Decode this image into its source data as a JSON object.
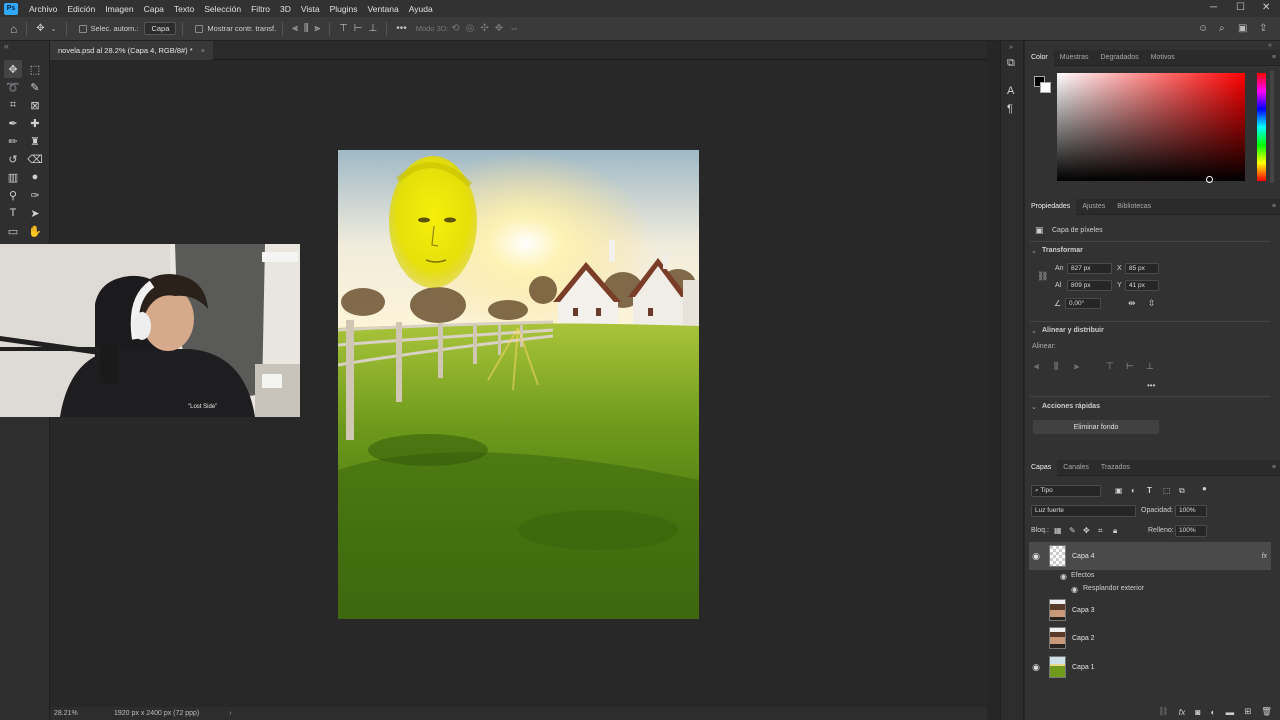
{
  "app": {
    "logo": "Ps"
  },
  "menu": [
    "Archivo",
    "Edición",
    "Imagen",
    "Capa",
    "Texto",
    "Selección",
    "Filtro",
    "3D",
    "Vista",
    "Plugins",
    "Ventana",
    "Ayuda"
  ],
  "options": {
    "auto_select_label": "Selec. autom.:",
    "auto_select_value": "Capa",
    "show_transform_label": "Mostrar contr. transf.",
    "mode_3d_label": "Modo 3D:"
  },
  "document": {
    "tab_title": "novela.psd al 28.2% (Capa 4, RGB/8#) *",
    "zoom": "28.21%",
    "size_info": "1920 px x 2400 px (72 ppp)"
  },
  "color_panel": {
    "tabs": [
      "Color",
      "Muestras",
      "Degradados",
      "Motivos"
    ]
  },
  "properties_panel": {
    "tabs": [
      "Propiedades",
      "Ajustes",
      "Bibliotecas"
    ],
    "type_label": "Capa de píxeles",
    "transform_title": "Transformar",
    "w_label": "An",
    "w_value": "827 px",
    "h_label": "Al",
    "h_value": "809 px",
    "x_label": "X",
    "x_value": "85 px",
    "y_label": "Y",
    "y_value": "41 px",
    "angle_value": "0,00°",
    "align_title": "Alinear y distribuir",
    "align_label": "Alinear:",
    "quick_title": "Acciones rápidas",
    "remove_bg_label": "Eliminar fondo"
  },
  "layers_panel": {
    "tabs": [
      "Capas",
      "Canales",
      "Trazados"
    ],
    "filter_label": "Tipo",
    "blend_mode": "Luz fuerte",
    "opacity_label": "Opacidad:",
    "opacity_value": "100%",
    "lock_label": "Bloq.:",
    "fill_label": "Relleno:",
    "fill_value": "100%",
    "layers": [
      {
        "name": "Capa 4",
        "visible": true,
        "selected": true
      },
      {
        "name": "Capa 3",
        "visible": false,
        "selected": false
      },
      {
        "name": "Capa 2",
        "visible": false,
        "selected": false
      },
      {
        "name": "Capa 1",
        "visible": true,
        "selected": false
      }
    ],
    "effects_label": "Efectos",
    "effect_name": "Resplandor exterior",
    "fx_icon": "fx"
  },
  "webcam": {
    "shirt_text": "\"Lost Side\""
  },
  "icons": {
    "eye": "◉"
  }
}
